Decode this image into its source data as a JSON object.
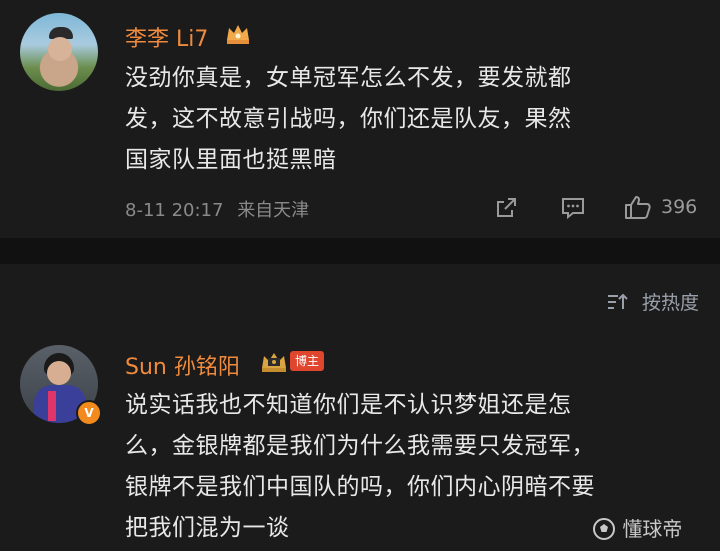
{
  "comment1": {
    "username": "李李 Li7",
    "lines": [
      "没劲你真是，女单冠军怎么不发，要发就都",
      "发，这不故意引战吗，你们还是队友，果然",
      "国家队里面也挺黑暗"
    ],
    "timestamp": "8-11 20:17",
    "source": "来自天津",
    "likes": "396"
  },
  "sort": {
    "label": "按热度"
  },
  "comment2": {
    "username": "Sun 孙铭阳",
    "badge": "博主",
    "lines": [
      "说实话我也不知道你们是不认识梦姐还是怎",
      "么，金银牌都是我们为什么我需要只发冠军，",
      "银牌不是我们中国队的吗，你们内心阴暗不要",
      "把我们混为一谈"
    ]
  },
  "watermark": {
    "text": "懂球帝"
  },
  "colors": {
    "username": "#f08a3c",
    "text": "#e8e8e8",
    "meta": "#8a8a8a",
    "badge": "#e0452e",
    "verified": "#f28a1d"
  }
}
